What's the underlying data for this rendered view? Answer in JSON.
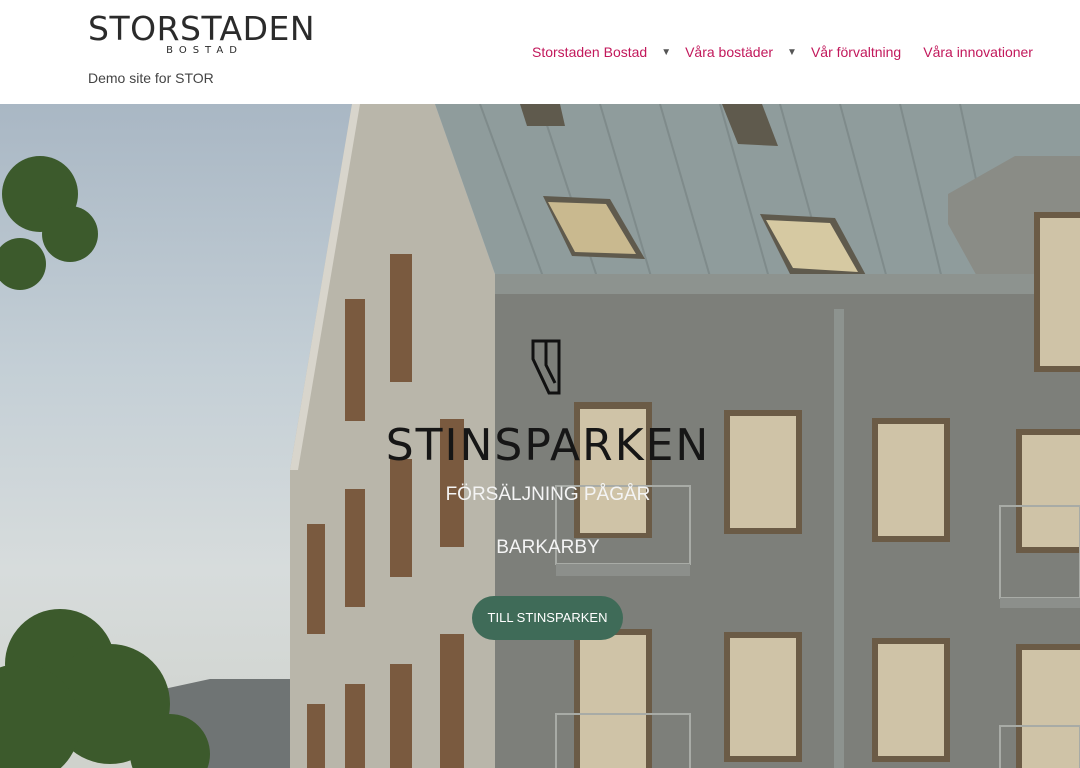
{
  "site": {
    "logo_main": "STORSTADEN",
    "logo_sub": "BOSTAD",
    "tagline": "Demo site for STOR"
  },
  "nav": {
    "items": [
      {
        "label": "Storstaden Bostad",
        "has_dropdown": true
      },
      {
        "label": "Våra bostäder",
        "has_dropdown": true
      },
      {
        "label": "Vår förvaltning",
        "has_dropdown": false
      },
      {
        "label": "Våra innovationer",
        "has_dropdown": false
      }
    ],
    "accent_color": "#c2185b"
  },
  "hero": {
    "title": "STINSPARKEN",
    "subtitle": "FÖRSÄLJNING PÅGÅR",
    "location": "BARKARBY",
    "button_label": "TILL STINSPARKEN",
    "button_color": "#3f6b58",
    "icon": "stinsparken-logo-icon"
  }
}
